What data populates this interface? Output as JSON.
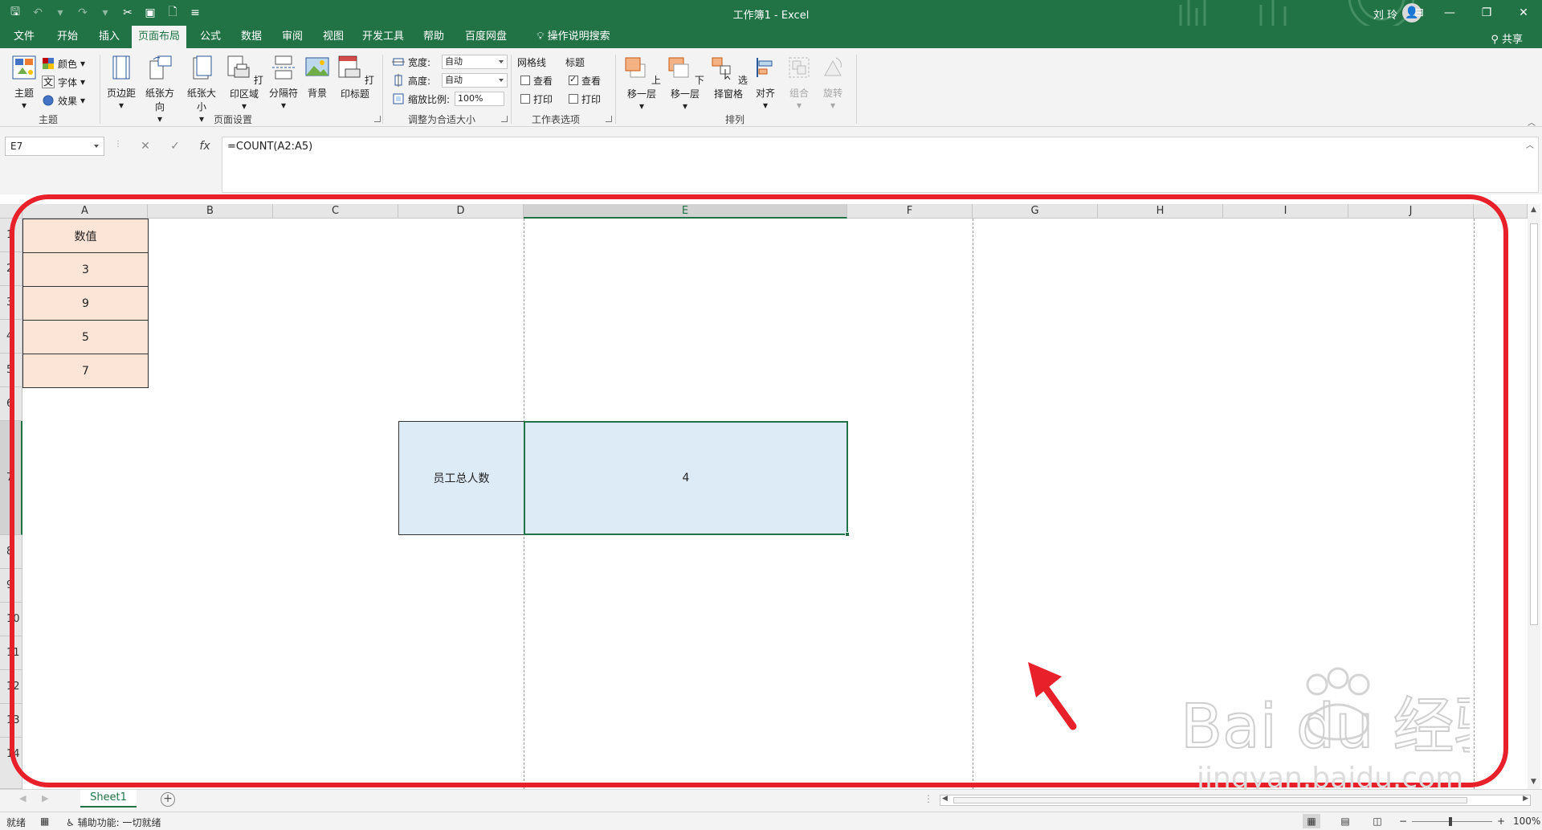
{
  "window": {
    "title": "工作簿1  -  Excel",
    "user": "刘 玲"
  },
  "ribbon_tabs": [
    {
      "label": "文件"
    },
    {
      "label": "开始"
    },
    {
      "label": "插入"
    },
    {
      "label": "页面布局",
      "active": true
    },
    {
      "label": "公式"
    },
    {
      "label": "数据"
    },
    {
      "label": "审阅"
    },
    {
      "label": "视图"
    },
    {
      "label": "开发工具"
    },
    {
      "label": "帮助"
    },
    {
      "label": "百度网盘"
    },
    {
      "label": "操作说明搜索"
    }
  ],
  "share_label": "共享",
  "theme_group": {
    "label": "主题",
    "theme_btn": "主题",
    "colors": "颜色",
    "fonts": "字体",
    "effects": "效果"
  },
  "page_setup": {
    "label": "页面设置",
    "margins": "页边距",
    "orientation": "纸张方向",
    "size": "纸张大小",
    "print_area": "打印区域",
    "breaks": "分隔符",
    "background": "背景",
    "print_titles": "打印标题"
  },
  "scale_fit": {
    "label": "调整为合适大小",
    "width_label": "宽度:",
    "width_value": "自动",
    "height_label": "高度:",
    "height_value": "自动",
    "scale_label": "缩放比例:",
    "scale_value": "100%"
  },
  "sheet_options": {
    "label": "工作表选项",
    "gridlines": "网格线",
    "headings": "标题",
    "view": "查看",
    "print": "打印",
    "gridlines_view": false,
    "gridlines_print": false,
    "headings_view": true,
    "headings_print": false
  },
  "arrange": {
    "label": "排列",
    "bring_forward": "上移一层",
    "send_backward": "下移一层",
    "selection_pane": "选择窗格",
    "align": "对齐",
    "group": "组合",
    "rotate": "旋转"
  },
  "formula_bar": {
    "name_box": "E7",
    "formula": "=COUNT(A2:A5)",
    "fx": "fx"
  },
  "columns": [
    "A",
    "B",
    "C",
    "D",
    "E",
    "F",
    "G",
    "H",
    "I",
    "J"
  ],
  "row_numbers": [
    "1",
    "2",
    "3",
    "4",
    "5",
    "6",
    "7",
    "8",
    "9",
    "10",
    "11",
    "12",
    "13",
    "14"
  ],
  "cells": {
    "A1": "数值",
    "A2": "3",
    "A3": "9",
    "A4": "5",
    "A5": "7",
    "D7": "员工总人数",
    "E7": "4"
  },
  "sheet_tab": "Sheet1",
  "status": {
    "ready": "就绪",
    "accessibility": "辅助功能: 一切就绪",
    "zoom": "100%"
  },
  "colors": {
    "excel_green": "#217346",
    "highlight_orange": "#fce4d6",
    "highlight_blue": "#ddebf7",
    "annotation_red": "#e8202a"
  },
  "watermark": {
    "brand": "Bai du 经验",
    "url": "jingyan.baidu.com"
  }
}
